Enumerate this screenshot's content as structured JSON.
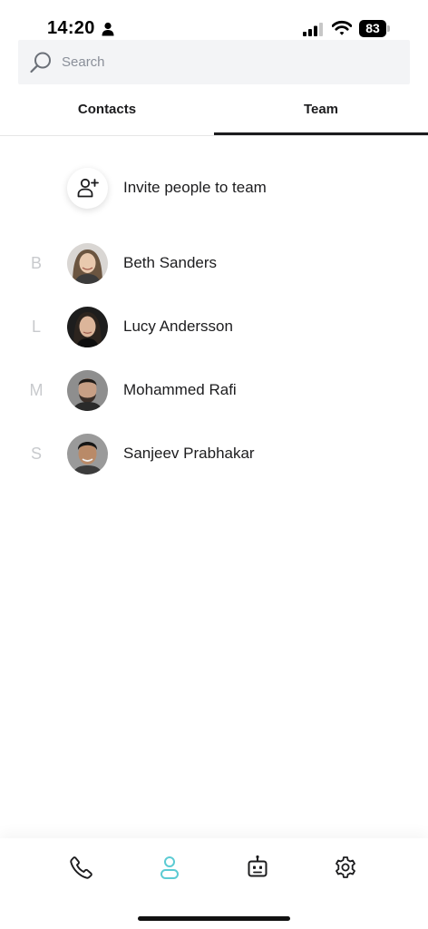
{
  "status_bar": {
    "time": "14:20",
    "battery": "83",
    "icons": [
      "person-icon",
      "signal-icon",
      "wifi-icon",
      "battery-icon"
    ]
  },
  "search": {
    "placeholder": "Search",
    "value": "",
    "icon": "search-icon"
  },
  "tabs": [
    {
      "label": "Contacts",
      "active": false
    },
    {
      "label": "Team",
      "active": true
    }
  ],
  "invite": {
    "label": "Invite people to team",
    "icon": "add-user-icon"
  },
  "members": [
    {
      "letter": "B",
      "name": "Beth Sanders"
    },
    {
      "letter": "L",
      "name": "Lucy Andersson"
    },
    {
      "letter": "M",
      "name": "Mohammed Rafi"
    },
    {
      "letter": "S",
      "name": "Sanjeev Prabhakar"
    }
  ],
  "bottom_nav": [
    {
      "icon": "phone-icon",
      "active": false
    },
    {
      "icon": "contacts-icon",
      "active": true
    },
    {
      "icon": "bot-icon",
      "active": false
    },
    {
      "icon": "gear-icon",
      "active": false
    }
  ],
  "colors": {
    "accent": "#5ccbd3",
    "text": "#1c1c1e",
    "muted_letter": "#c8cacd",
    "search_bg": "#f3f4f6"
  }
}
